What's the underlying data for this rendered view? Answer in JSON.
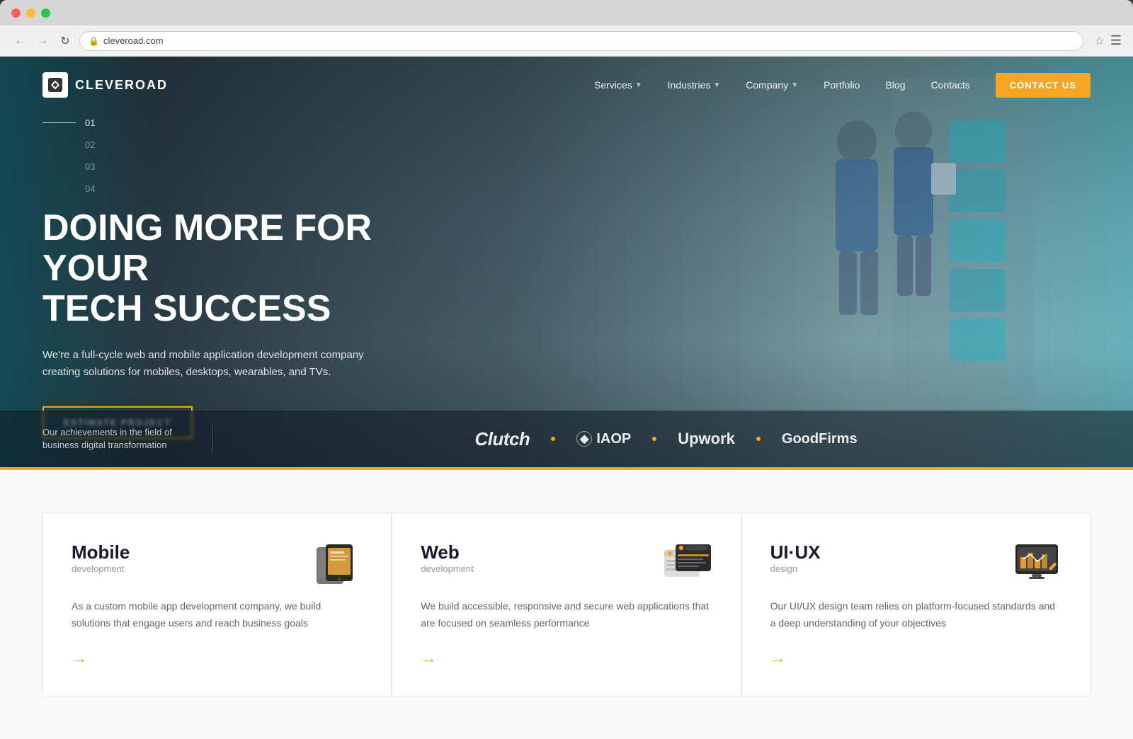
{
  "browser": {
    "address": "cleveroad.com",
    "back_title": "Back",
    "forward_title": "Forward",
    "refresh_title": "Refresh"
  },
  "navbar": {
    "logo_text": "CLEVEROAD",
    "links": [
      {
        "label": "Services",
        "has_dropdown": true
      },
      {
        "label": "Industries",
        "has_dropdown": true
      },
      {
        "label": "Company",
        "has_dropdown": true
      },
      {
        "label": "Portfolio",
        "has_dropdown": false
      },
      {
        "label": "Blog",
        "has_dropdown": false
      },
      {
        "label": "Contacts",
        "has_dropdown": false
      }
    ],
    "contact_btn": "CONTACT US"
  },
  "hero": {
    "slide_numbers": [
      "01",
      "02",
      "03",
      "04"
    ],
    "title_line1": "DOING MORE FOR YOUR",
    "title_line2": "TECH SUCCESS",
    "subtitle": "We're a full-cycle web and mobile application development company creating solutions for mobiles, desktops, wearables, and TVs.",
    "cta_button": "ESTIMATE PROJECT",
    "achievements_text": "Our achievements in the field of business digital transformation",
    "partners": [
      "Clutch",
      "IAOP",
      "Upwork",
      "GoodFirms"
    ]
  },
  "services": {
    "cards": [
      {
        "name": "Mobile",
        "type": "development",
        "desc": "As a custom mobile app development company, we build solutions that engage users and reach business goals"
      },
      {
        "name": "Web",
        "type": "development",
        "desc": "We build accessible, responsive and secure web applications that are focused on seamless performance"
      },
      {
        "name": "UI·UX",
        "type": "design",
        "desc": "Our UI/UX design team relies on platform-focused standards and a deep understanding of your objectives"
      }
    ]
  },
  "colors": {
    "orange": "#f5a623",
    "dark": "#1a1a2e",
    "text_light": "rgba(255,255,255,0.85)"
  }
}
